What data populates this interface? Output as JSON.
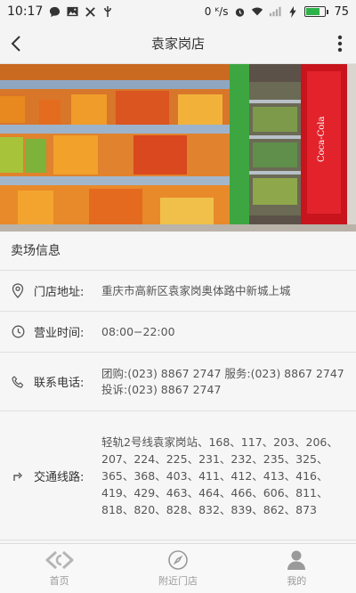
{
  "statusbar": {
    "time": "10:17",
    "speed": "0 ᴷ/s",
    "battery": "75"
  },
  "header": {
    "title": "袁家岗店"
  },
  "section": {
    "title": "卖场信息"
  },
  "info": {
    "address": {
      "label": "门店地址:",
      "value": "重庆市高新区袁家岗奥体路中新城上城"
    },
    "hours": {
      "label": "营业时间:",
      "value": "08:00−22:00"
    },
    "phone": {
      "label": "联系电话:",
      "value": "团购:(023) 8867 2747 服务:(023) 8867 2747 投诉:(023) 8867 2747"
    },
    "transit": {
      "label": "交通线路:",
      "value": "轻轨2号线袁家岗站、168、117、203、206、207、224、225、231、232、235、325、365、368、403、411、412、413、416、419、429、463、464、466、606、811、818、820、828、832、839、862、873"
    }
  },
  "tabs": [
    {
      "label": "首页",
      "icon": "carrefour-logo-icon"
    },
    {
      "label": "附近门店",
      "icon": "compass-icon"
    },
    {
      "label": "我的",
      "icon": "user-icon"
    }
  ],
  "colors": {
    "battery_fill": "#2db34a",
    "tab_inactive": "#9a9a9a"
  }
}
